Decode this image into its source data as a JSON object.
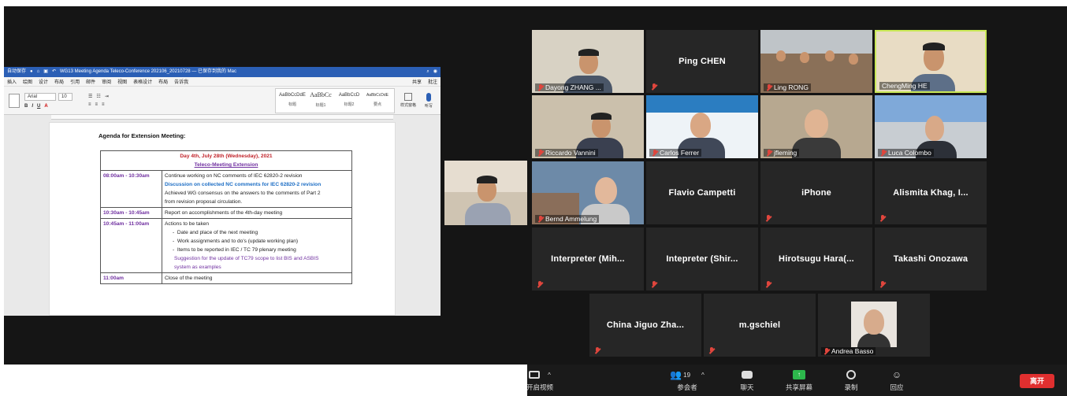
{
  "word": {
    "title": "WG13 Meeting Agenda Teleco-Conference 202106_20210728 — 已保存到我的 Mac",
    "autosave": "自动保存",
    "menu": [
      "插入",
      "绘图",
      "设计",
      "布局",
      "引用",
      "邮件",
      "审阅",
      "视图",
      "表格设计",
      "布局",
      "告诉我"
    ],
    "share": "共享",
    "comment": "批注",
    "font_name": "Arial",
    "font_size": "10",
    "styles": [
      {
        "sample": "AaBbCcDdE",
        "name": "标题"
      },
      {
        "sample": "AaBbCc",
        "name": "标题1"
      },
      {
        "sample": "AaBbCcD",
        "name": "标题2"
      },
      {
        "sample": "AaBbCcDdE",
        "name": "要点"
      }
    ],
    "pane_label": "样式窗格",
    "dictate": "听写",
    "heading": "Agenda for Extension Meeting:",
    "day_title": "Day 4th, July 28th (Wednesday), 2021",
    "subtitle": "Teleco-Meeting Extension",
    "rows": [
      {
        "time": "08:00am - 10:30am",
        "l1": "Continue working on NC comments of IEC 62820-2 revision",
        "l2": "Discussion on collected NC comments for IEC 62820-2 revision",
        "l3": "Achieved WG consensus on the answers to the comments of Part 2",
        "l4": "from revision proposal circulation."
      },
      {
        "time": "10:30am - 10:45am",
        "l1": "Report on accomplishments of the 4th-day meeting"
      },
      {
        "time": "10:45am - 11:00am",
        "l1": "Actions to be taken",
        "b1": "Date and place of the next meeting",
        "b2": "Work assignments and to do's (update working plan)",
        "b3": "Items to be reported in IEC / TC 79 plenary meeting",
        "p1": "Suggestion for the update of TC79 scope to list BIS and ASBIS",
        "p2": "system as examples"
      },
      {
        "time": "11:00am",
        "l1": "Close of the meeting"
      }
    ]
  },
  "participants": [
    {
      "label": "Dayong ZHANG ..."
    },
    {
      "name": "Ping CHEN"
    },
    {
      "label": "Ling RONG"
    },
    {
      "label": "ChengMing HE"
    },
    {
      "label": "Riccardo Vannini"
    },
    {
      "label": "Carlos Ferrer"
    },
    {
      "label": "jfleming"
    },
    {
      "label": "Luca Colombo"
    },
    {
      "label": "Bernd Ammelung"
    },
    {
      "name": "Flavio Campetti"
    },
    {
      "name": "iPhone"
    },
    {
      "name": "Alismita Khag, I..."
    },
    {
      "name": "Interpreter  (Mih..."
    },
    {
      "name": "Intepreter  (Shir..."
    },
    {
      "name": "Hirotsugu  Hara(..."
    },
    {
      "name": "Takashi Onozawa"
    },
    {
      "name": "China  Jiguo Zha..."
    },
    {
      "name": "m.gschiel"
    },
    {
      "label": "Andrea Basso"
    }
  ],
  "toolbar": {
    "video": "开启视频",
    "participants": "参会者",
    "participants_count": "19",
    "chat": "聊天",
    "share": "共享屏幕",
    "record": "录制",
    "reactions": "回应",
    "leave": "离开"
  },
  "colors": {
    "active_speaker": "#c9e857",
    "share_green": "#2db84c",
    "leave_red": "#e02f2f",
    "mic_muted": "#e0463d"
  }
}
